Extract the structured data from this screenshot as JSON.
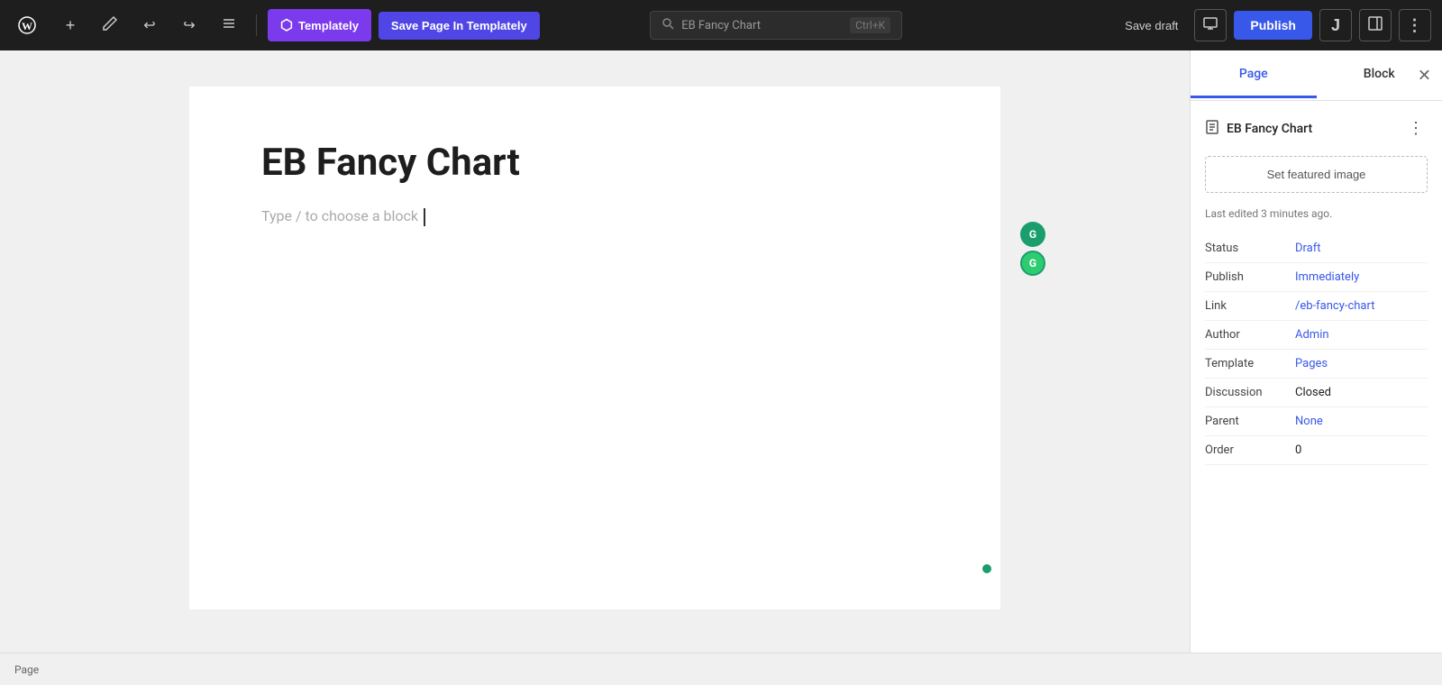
{
  "toolbar": {
    "wp_logo": "W",
    "add_label": "+",
    "edit_label": "✏",
    "undo_label": "↩",
    "redo_label": "↪",
    "list_label": "≡",
    "templately_label": "Templately",
    "save_templately_label": "Save Page In Templately",
    "search_placeholder": "EB Fancy Chart",
    "search_shortcut": "Ctrl+K",
    "save_draft_label": "Save draft",
    "publish_label": "Publish",
    "jetpack_icon": "J",
    "toggle_icon": "⬛"
  },
  "editor": {
    "page_title": "EB Fancy Chart",
    "block_placeholder": "Type / to choose a block"
  },
  "sidebar": {
    "tab_page": "Page",
    "tab_block": "Block",
    "page_title": "EB Fancy Chart",
    "featured_image_label": "Set featured image",
    "last_edited": "Last edited 3 minutes ago.",
    "status_label": "Status",
    "status_value": "Draft",
    "publish_label": "Publish",
    "publish_value": "Immediately",
    "link_label": "Link",
    "link_value": "/eb-fancy-chart",
    "author_label": "Author",
    "author_value": "Admin",
    "template_label": "Template",
    "template_value": "Pages",
    "discussion_label": "Discussion",
    "discussion_value": "Closed",
    "parent_label": "Parent",
    "parent_value": "None",
    "order_label": "Order",
    "order_value": "0"
  },
  "statusbar": {
    "label": "Page"
  },
  "colors": {
    "active_tab": "#3858e9",
    "link": "#3858e9",
    "publish_btn": "#3858e9",
    "templately_btn": "#7c3aed",
    "save_templately_btn": "#4f46e5"
  }
}
